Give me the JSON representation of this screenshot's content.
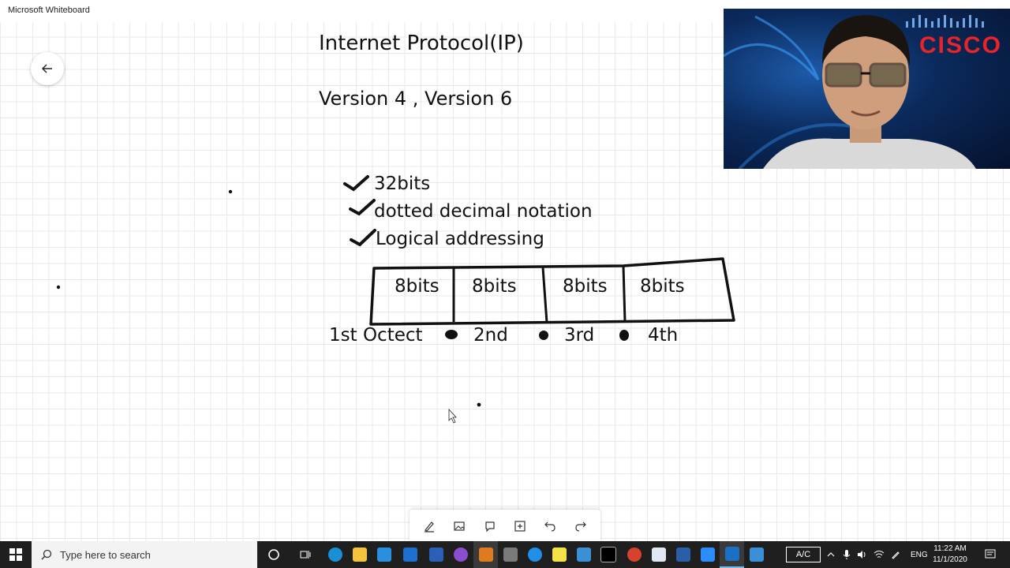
{
  "window": {
    "title": "Microsoft Whiteboard"
  },
  "board": {
    "title": "Internet Protocol(IP)",
    "versions": "Version 4 , Version 6",
    "checklist": [
      "32bits",
      "dotted decimal notation",
      "Logical addressing"
    ],
    "cells": [
      "8bits",
      "8bits",
      "8bits",
      "8bits"
    ],
    "octets": [
      "1st Octect",
      "2nd",
      "3rd",
      "4th"
    ]
  },
  "webcam": {
    "brand": "CISCO"
  },
  "toolbar": {
    "tools": [
      "pen-icon",
      "image-icon",
      "lasso-icon",
      "add-icon",
      "undo-icon",
      "redo-icon"
    ]
  },
  "taskbar": {
    "search_placeholder": "Type here to search",
    "ac_label": "A/C",
    "language": "ENG",
    "time": "11:22 AM",
    "date": "11/1/2020"
  },
  "colors": {
    "ink": "#111111",
    "taskbar": "#1f1f1f",
    "cisco": "#e8232a"
  }
}
